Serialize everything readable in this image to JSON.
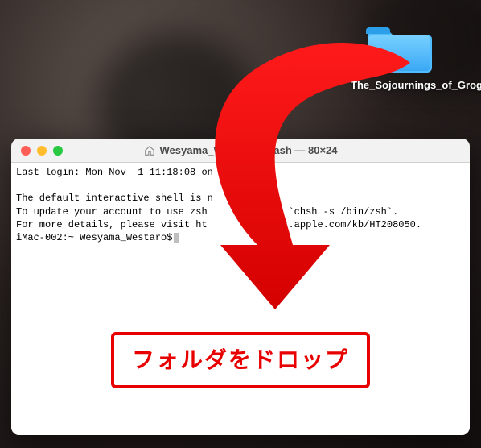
{
  "desktop": {
    "folder": {
      "label": "The_Sojournings_of_Grog",
      "color": "#3bb2ff"
    }
  },
  "terminal": {
    "window": {
      "title_full": "Wesyama_We            -bash — 80×24",
      "title_prefix": "Wesyama_We",
      "title_suffix": "-bash — 80×24"
    },
    "lines": {
      "l0": "Last login: Mon Nov  1 11:18:08 on ",
      "blank": "",
      "l1": "The default interactive shell is n",
      "l2_a": "To update your account to use zsh",
      "l2_b": "run `chsh -s /bin/zsh`.",
      "l3_a": "For more details, please visit ht",
      "l3_b": "port.apple.com/kb/HT208050.",
      "prompt": "iMac-002:~ Wesyama_Westaro$"
    }
  },
  "annotation": {
    "drop_label": "フォルダをドロップ",
    "arrow_color": "#e80000"
  }
}
